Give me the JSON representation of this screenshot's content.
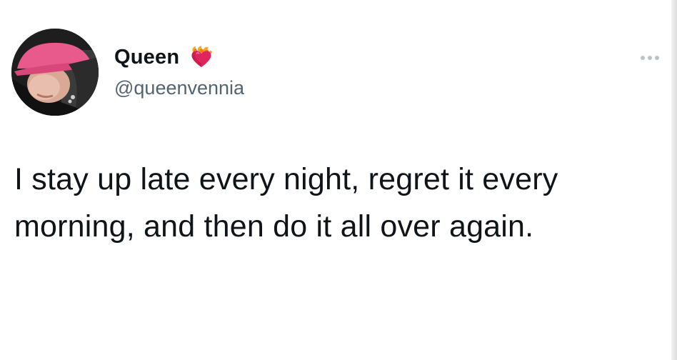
{
  "user": {
    "display_name": "Queen",
    "handle": "@queenvennia",
    "avatar_icon": "profile-photo",
    "badge_icon": "heart-on-fire-icon"
  },
  "actions": {
    "more_icon": "more-options-icon"
  },
  "tweet": {
    "line1": "I stay up late every night, regret it every",
    "line2": "morning, and then do it all over again."
  },
  "colors": {
    "text_primary": "#0f1419",
    "text_secondary": "#536471",
    "background": "#ffffff"
  }
}
